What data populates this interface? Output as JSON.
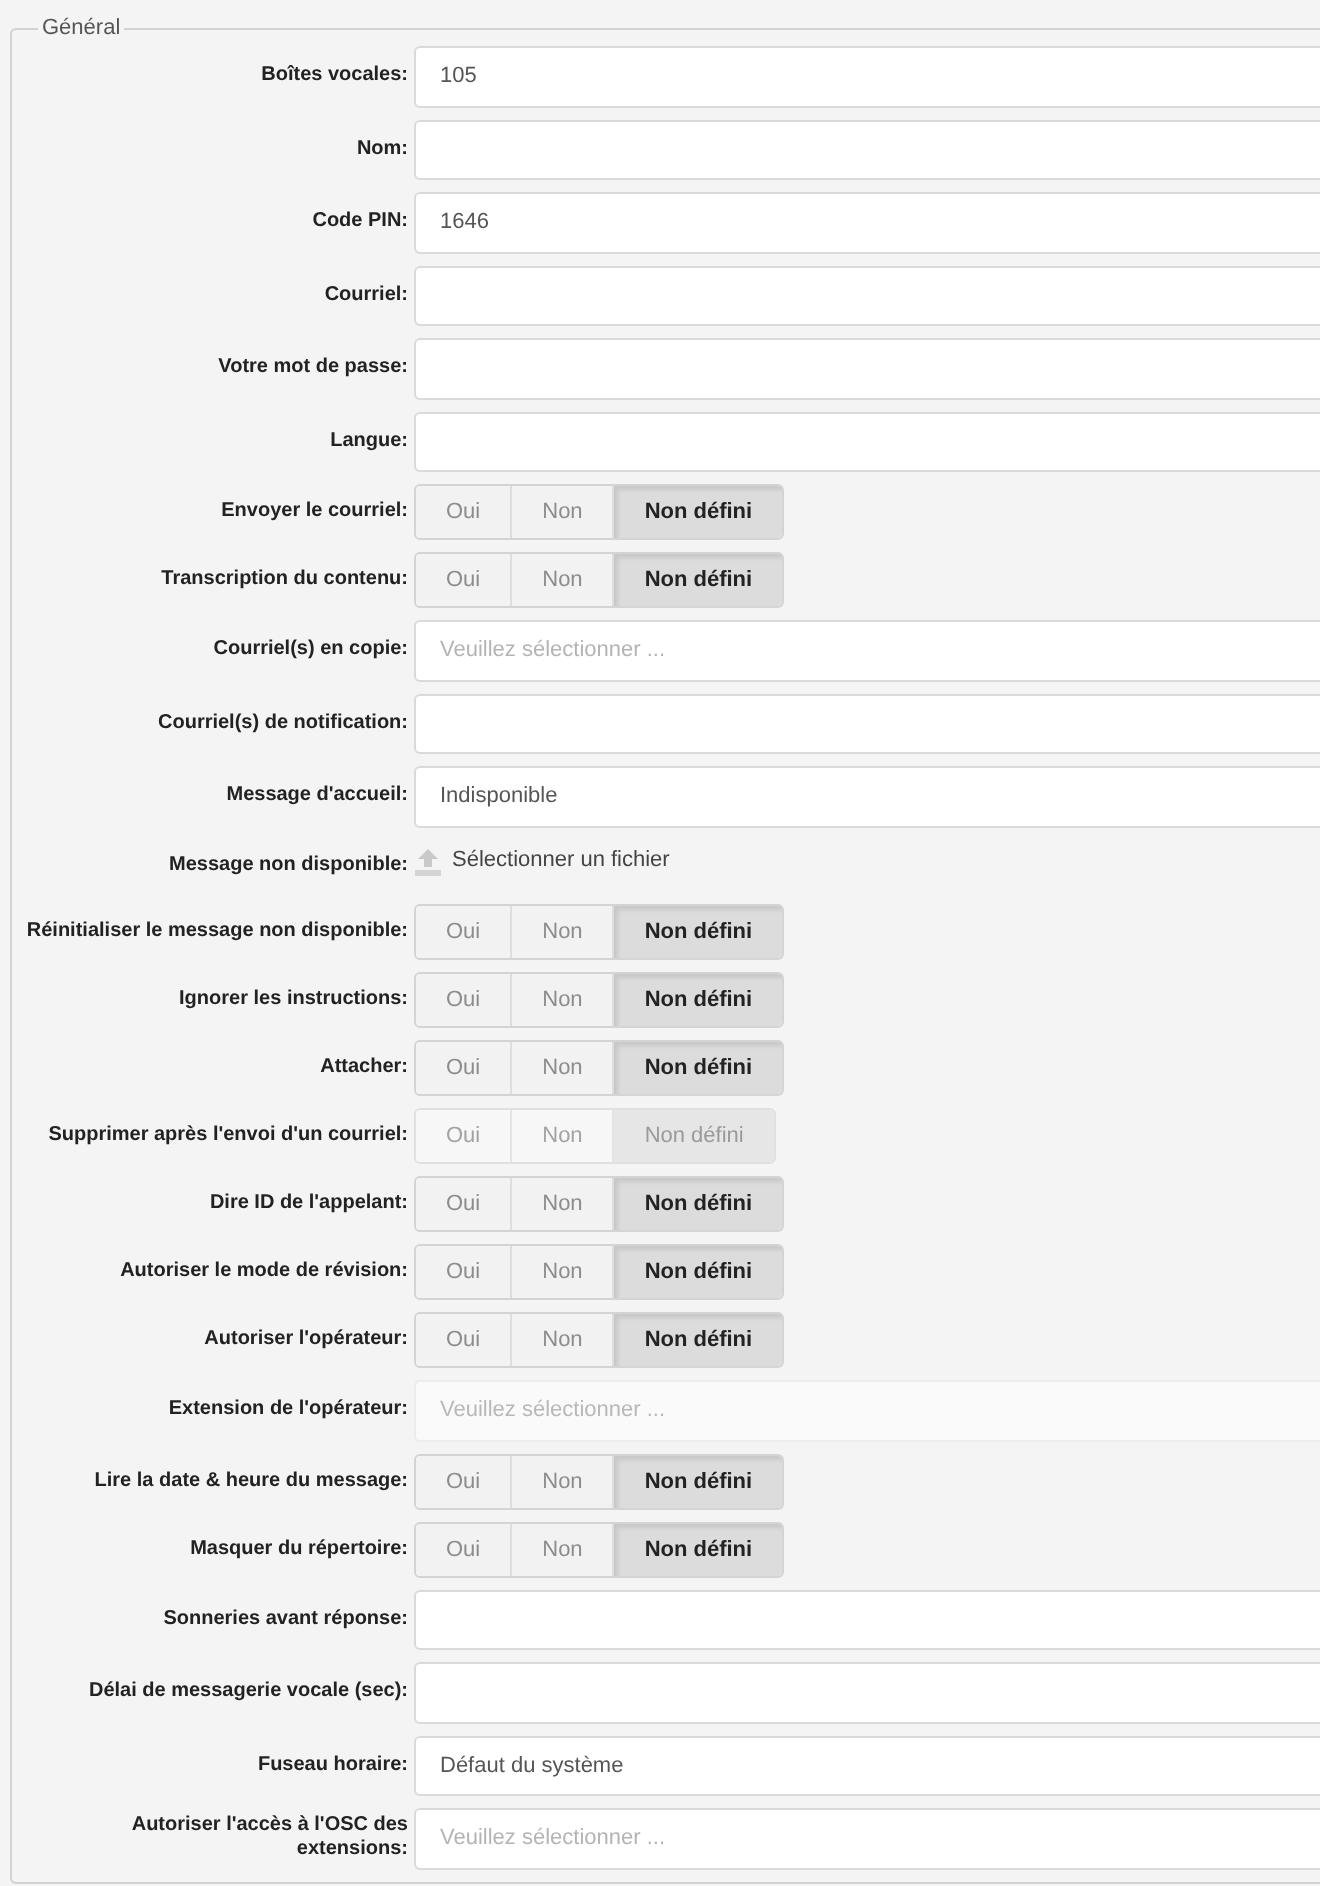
{
  "fieldset": {
    "legend": "Général",
    "fields": [
      {
        "kind": "input",
        "label": "Boîtes vocales:",
        "value": "105",
        "disabled": false
      },
      {
        "kind": "input",
        "label": "Nom:",
        "disabled": false
      },
      {
        "kind": "input",
        "label": "Code PIN:",
        "value": "1646",
        "disabled": false
      },
      {
        "kind": "input",
        "label": "Courriel:",
        "disabled": false
      },
      {
        "kind": "input",
        "label": "Votre mot de passe:",
        "disabled": false
      },
      {
        "kind": "input",
        "label": "Langue:",
        "disabled": false
      },
      {
        "kind": "toggle",
        "label": "Envoyer le courriel:",
        "disabled": false,
        "options": [
          {
            "label": "Oui",
            "selected": false
          },
          {
            "label": "Non",
            "selected": false
          },
          {
            "label": "Non défini",
            "selected": true
          }
        ]
      },
      {
        "kind": "toggle",
        "label": "Transcription du contenu:",
        "disabled": false,
        "options": [
          {
            "label": "Oui",
            "selected": false
          },
          {
            "label": "Non",
            "selected": false
          },
          {
            "label": "Non défini",
            "selected": true
          }
        ]
      },
      {
        "kind": "input",
        "label": "Courriel(s) en copie:",
        "placeholder": "Veuillez sélectionner ...",
        "disabled": false
      },
      {
        "kind": "input",
        "label": "Courriel(s) de notification:",
        "disabled": false
      },
      {
        "kind": "input",
        "label": "Message d'accueil:",
        "value": "Indisponible",
        "disabled": false
      },
      {
        "kind": "file",
        "label": "Message non disponible:",
        "button": "Sélectionner un fichier",
        "disabled": false
      },
      {
        "kind": "toggle",
        "label": "Réinitialiser le message non disponible:",
        "disabled": false,
        "options": [
          {
            "label": "Oui",
            "selected": false
          },
          {
            "label": "Non",
            "selected": false
          },
          {
            "label": "Non défini",
            "selected": true
          }
        ]
      },
      {
        "kind": "toggle",
        "label": "Ignorer les instructions:",
        "disabled": false,
        "options": [
          {
            "label": "Oui",
            "selected": false
          },
          {
            "label": "Non",
            "selected": false
          },
          {
            "label": "Non défini",
            "selected": true
          }
        ]
      },
      {
        "kind": "toggle",
        "label": "Attacher:",
        "disabled": false,
        "options": [
          {
            "label": "Oui",
            "selected": false
          },
          {
            "label": "Non",
            "selected": false
          },
          {
            "label": "Non défini",
            "selected": true
          }
        ]
      },
      {
        "kind": "toggle",
        "label": "Supprimer après l'envoi d'un courriel:",
        "disabled": true,
        "options": [
          {
            "label": "Oui",
            "selected": false
          },
          {
            "label": "Non",
            "selected": false
          },
          {
            "label": "Non défini",
            "selected": true
          }
        ]
      },
      {
        "kind": "toggle",
        "label": "Dire ID de l'appelant:",
        "disabled": false,
        "options": [
          {
            "label": "Oui",
            "selected": false
          },
          {
            "label": "Non",
            "selected": false
          },
          {
            "label": "Non défini",
            "selected": true
          }
        ]
      },
      {
        "kind": "toggle",
        "label": "Autoriser le mode de révision:",
        "disabled": false,
        "options": [
          {
            "label": "Oui",
            "selected": false
          },
          {
            "label": "Non",
            "selected": false
          },
          {
            "label": "Non défini",
            "selected": true
          }
        ]
      },
      {
        "kind": "toggle",
        "label": "Autoriser l'opérateur:",
        "disabled": false,
        "options": [
          {
            "label": "Oui",
            "selected": false
          },
          {
            "label": "Non",
            "selected": false
          },
          {
            "label": "Non défini",
            "selected": true
          }
        ]
      },
      {
        "kind": "input",
        "label": "Extension de l'opérateur:",
        "placeholder": "Veuillez sélectionner ...",
        "disabled": true
      },
      {
        "kind": "toggle",
        "label": "Lire la date & heure du message:",
        "disabled": false,
        "options": [
          {
            "label": "Oui",
            "selected": false
          },
          {
            "label": "Non",
            "selected": false
          },
          {
            "label": "Non défini",
            "selected": true
          }
        ]
      },
      {
        "kind": "toggle",
        "label": "Masquer du répertoire:",
        "disabled": false,
        "options": [
          {
            "label": "Oui",
            "selected": false
          },
          {
            "label": "Non",
            "selected": false
          },
          {
            "label": "Non défini",
            "selected": true
          }
        ]
      },
      {
        "kind": "input",
        "label": "Sonneries avant réponse:",
        "disabled": false
      },
      {
        "kind": "input",
        "label": "Délai de messagerie vocale (sec):",
        "disabled": false
      },
      {
        "kind": "input",
        "label": "Fuseau horaire:",
        "value": "Défaut du système",
        "disabled": false
      },
      {
        "kind": "input",
        "label": "Autoriser l'accès à l'OSC des extensions:",
        "placeholder": "Veuillez sélectionner ...",
        "disabled": false
      }
    ]
  }
}
